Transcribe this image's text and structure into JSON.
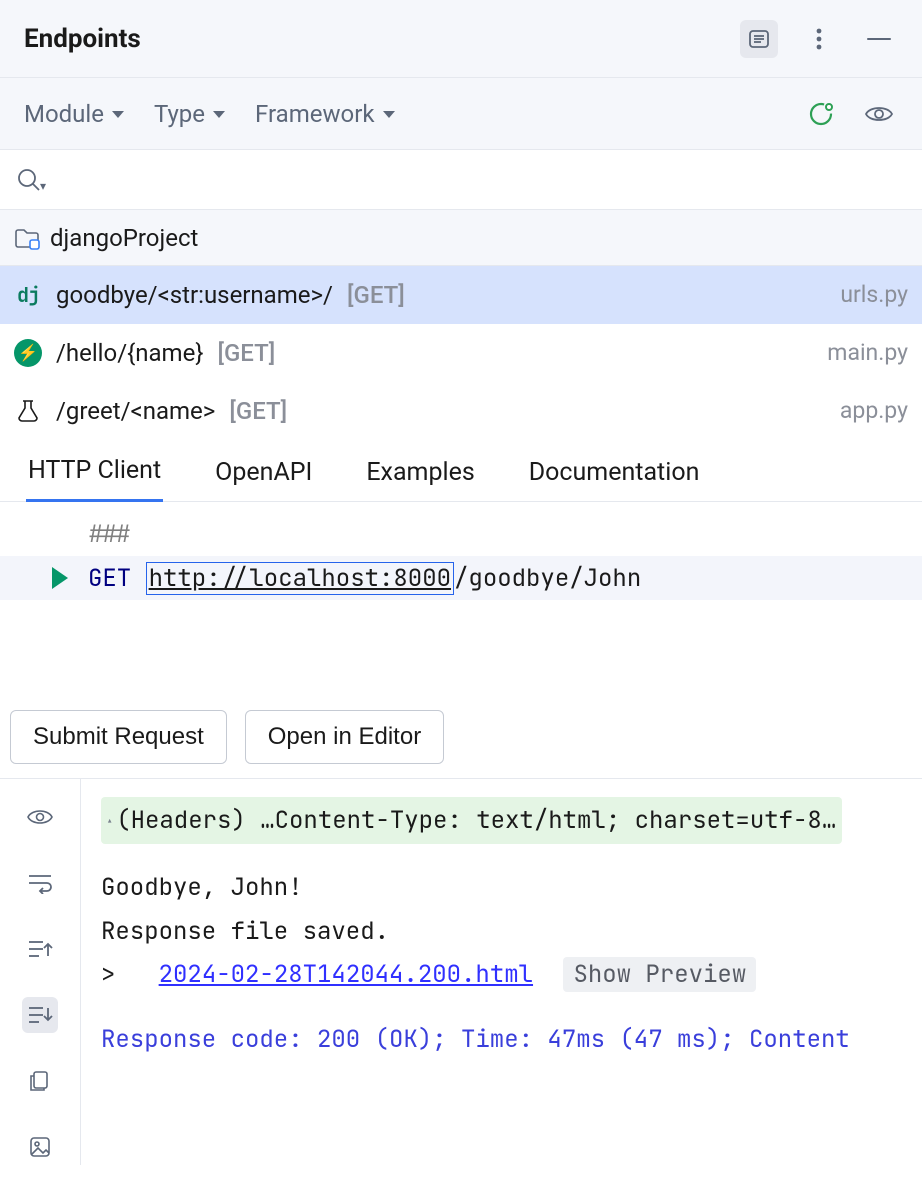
{
  "title": "Endpoints",
  "filters": {
    "module": "Module",
    "type": "Type",
    "framework": "Framework"
  },
  "project": {
    "name": "djangoProject"
  },
  "endpoints": [
    {
      "icon": "dj",
      "path": "goodbye/<str:username>/",
      "method": "[GET]",
      "file": "urls.py",
      "selected": true
    },
    {
      "icon": "bolt",
      "path": "/hello/{name}",
      "method": "[GET]",
      "file": "main.py",
      "selected": false
    },
    {
      "icon": "flask",
      "path": "/greet/<name>",
      "method": "[GET]",
      "file": "app.py",
      "selected": false
    }
  ],
  "tabs": [
    {
      "label": "HTTP Client",
      "active": true
    },
    {
      "label": "OpenAPI"
    },
    {
      "label": "Examples"
    },
    {
      "label": "Documentation"
    }
  ],
  "editor": {
    "sep": "###",
    "method": "GET",
    "url_boxed": "http://localhost:8000",
    "url_rest": "/goodbye/John"
  },
  "buttons": {
    "submit": "Submit Request",
    "open": "Open in Editor"
  },
  "response": {
    "headers_label": "(Headers)",
    "headers_value": "…Content-Type: text/html; charset=utf-8…",
    "body_line1": "Goodbye, John!",
    "body_line2": "Response file saved.",
    "angle": ">",
    "file_link": "2024-02-28T142044.200.html",
    "show_preview": "Show Preview",
    "status": "Response code: 200 (OK); Time: 47ms (47 ms); Content"
  }
}
